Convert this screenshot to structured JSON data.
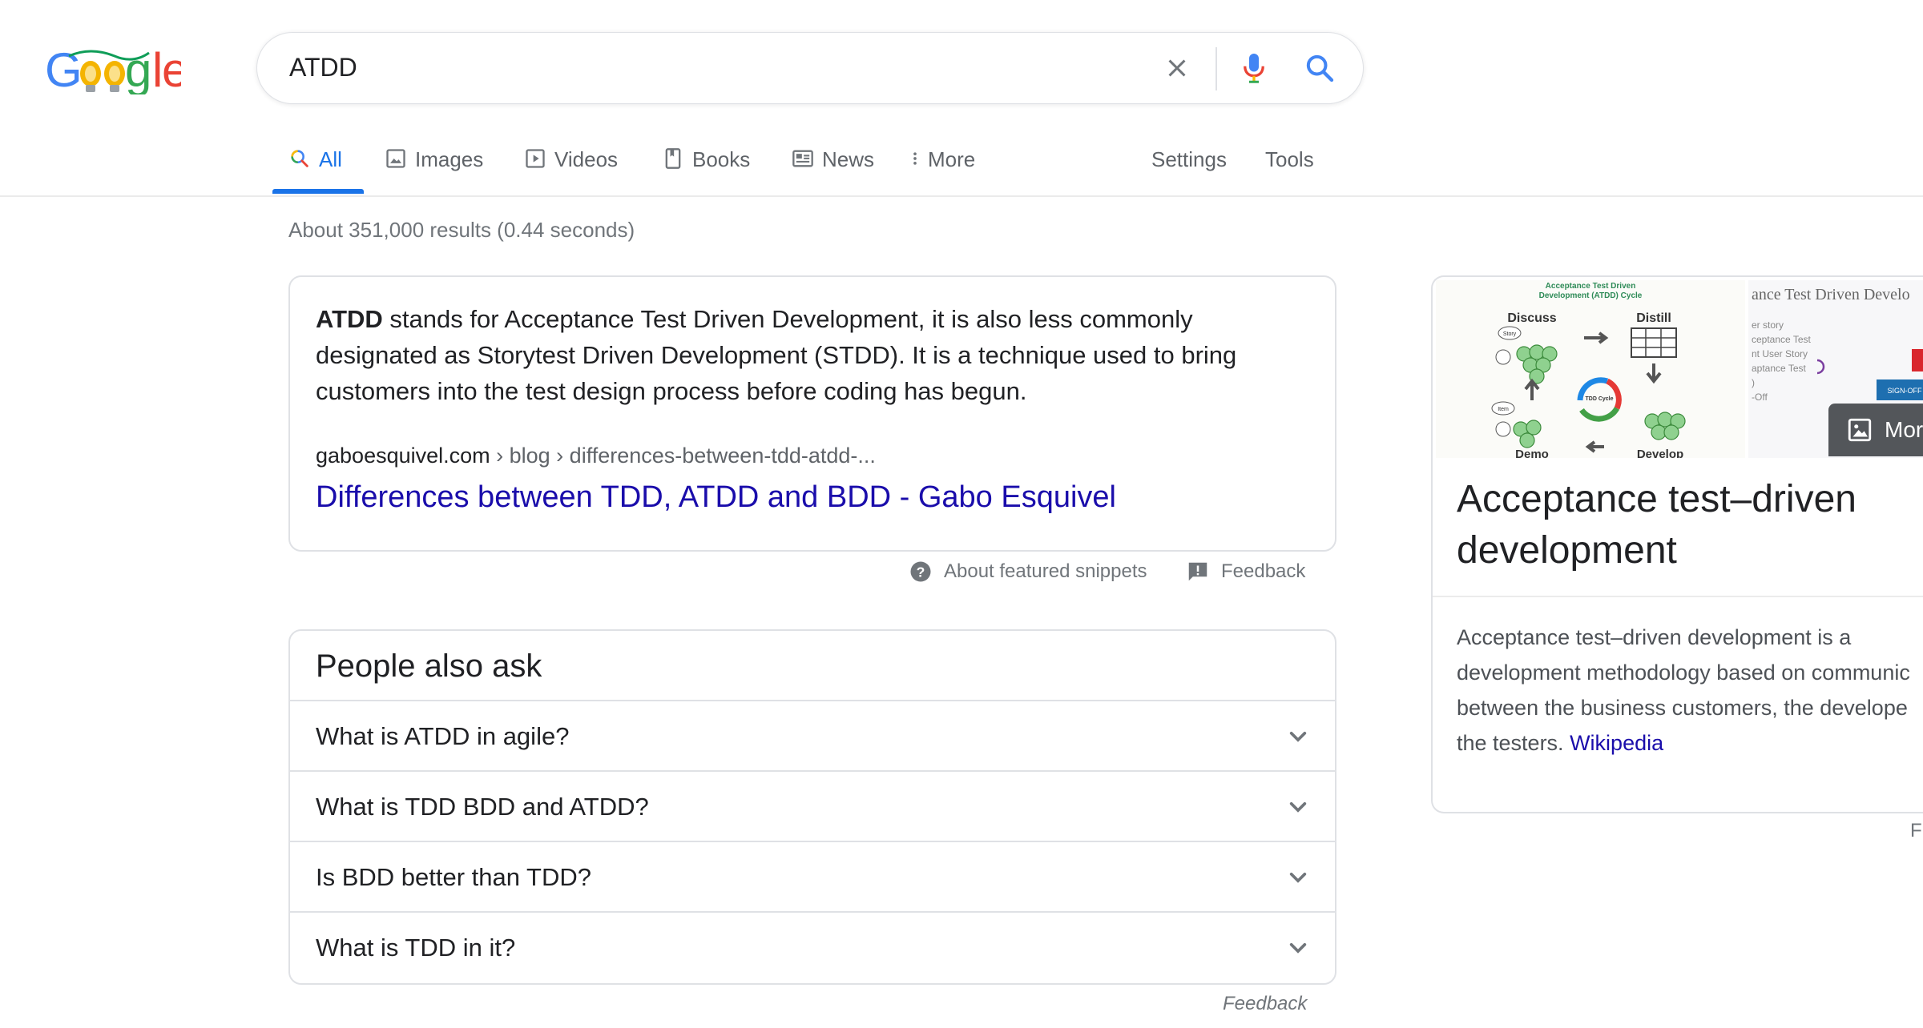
{
  "logo": {
    "alt": "Google"
  },
  "search": {
    "query": "ATDD"
  },
  "tabs": [
    {
      "label": "All",
      "icon": "search-icon"
    },
    {
      "label": "Images",
      "icon": "image-icon"
    },
    {
      "label": "Videos",
      "icon": "video-icon"
    },
    {
      "label": "Books",
      "icon": "book-icon"
    },
    {
      "label": "News",
      "icon": "news-icon"
    },
    {
      "label": "More",
      "icon": "more-vert-icon"
    }
  ],
  "tools": {
    "settings": "Settings",
    "tools": "Tools"
  },
  "result_stats": "About 351,000 results (0.44 seconds)",
  "featured_snippet": {
    "bold_term": "ATDD",
    "text": " stands for Acceptance Test Driven Development, it is also less commonly designated as Storytest Driven Development (STDD). It is a technique used to bring customers into the test design process before coding has begun.",
    "cite_domain": "gaboesquivel.com",
    "cite_path": " › blog › differences-between-tdd-atdd-...",
    "link_title": "Differences between TDD, ATDD and BDD - Gabo Esquivel",
    "about_label": "About featured snippets",
    "feedback_label": "Feedback"
  },
  "people_also_ask": {
    "title": "People also ask",
    "questions": [
      "What is ATDD in agile?",
      "What is TDD BDD and ATDD?",
      "Is BDD better than TDD?",
      "What is TDD in it?"
    ],
    "feedback_label": "Feedback"
  },
  "knowledge_panel": {
    "title": "Acceptance test–driven development",
    "more_images_label": "Mor",
    "desc_lines": [
      "Acceptance test–driven development is a",
      "development methodology based on communic",
      "between the business customers, the develope",
      "the testers. "
    ],
    "source": "Wikipedia",
    "footer_fragment": "F",
    "image1_labels": {
      "title_line1": "Acceptance Test Driven",
      "title_line2": "Development (ATDD) Cycle",
      "discuss": "Discuss",
      "distill": "Distill",
      "tdd_cycle": "TDD Cycle",
      "demo": "Demo",
      "develop": "Develop",
      "story": "Story",
      "item": "Item"
    },
    "image2_labels": {
      "header": "ance Test Driven Develo",
      "lines": [
        "er story",
        "ceptance Test",
        "nt User Story",
        "aptance Test",
        ")",
        "-Off"
      ],
      "button": "SIGN-OFF"
    }
  }
}
